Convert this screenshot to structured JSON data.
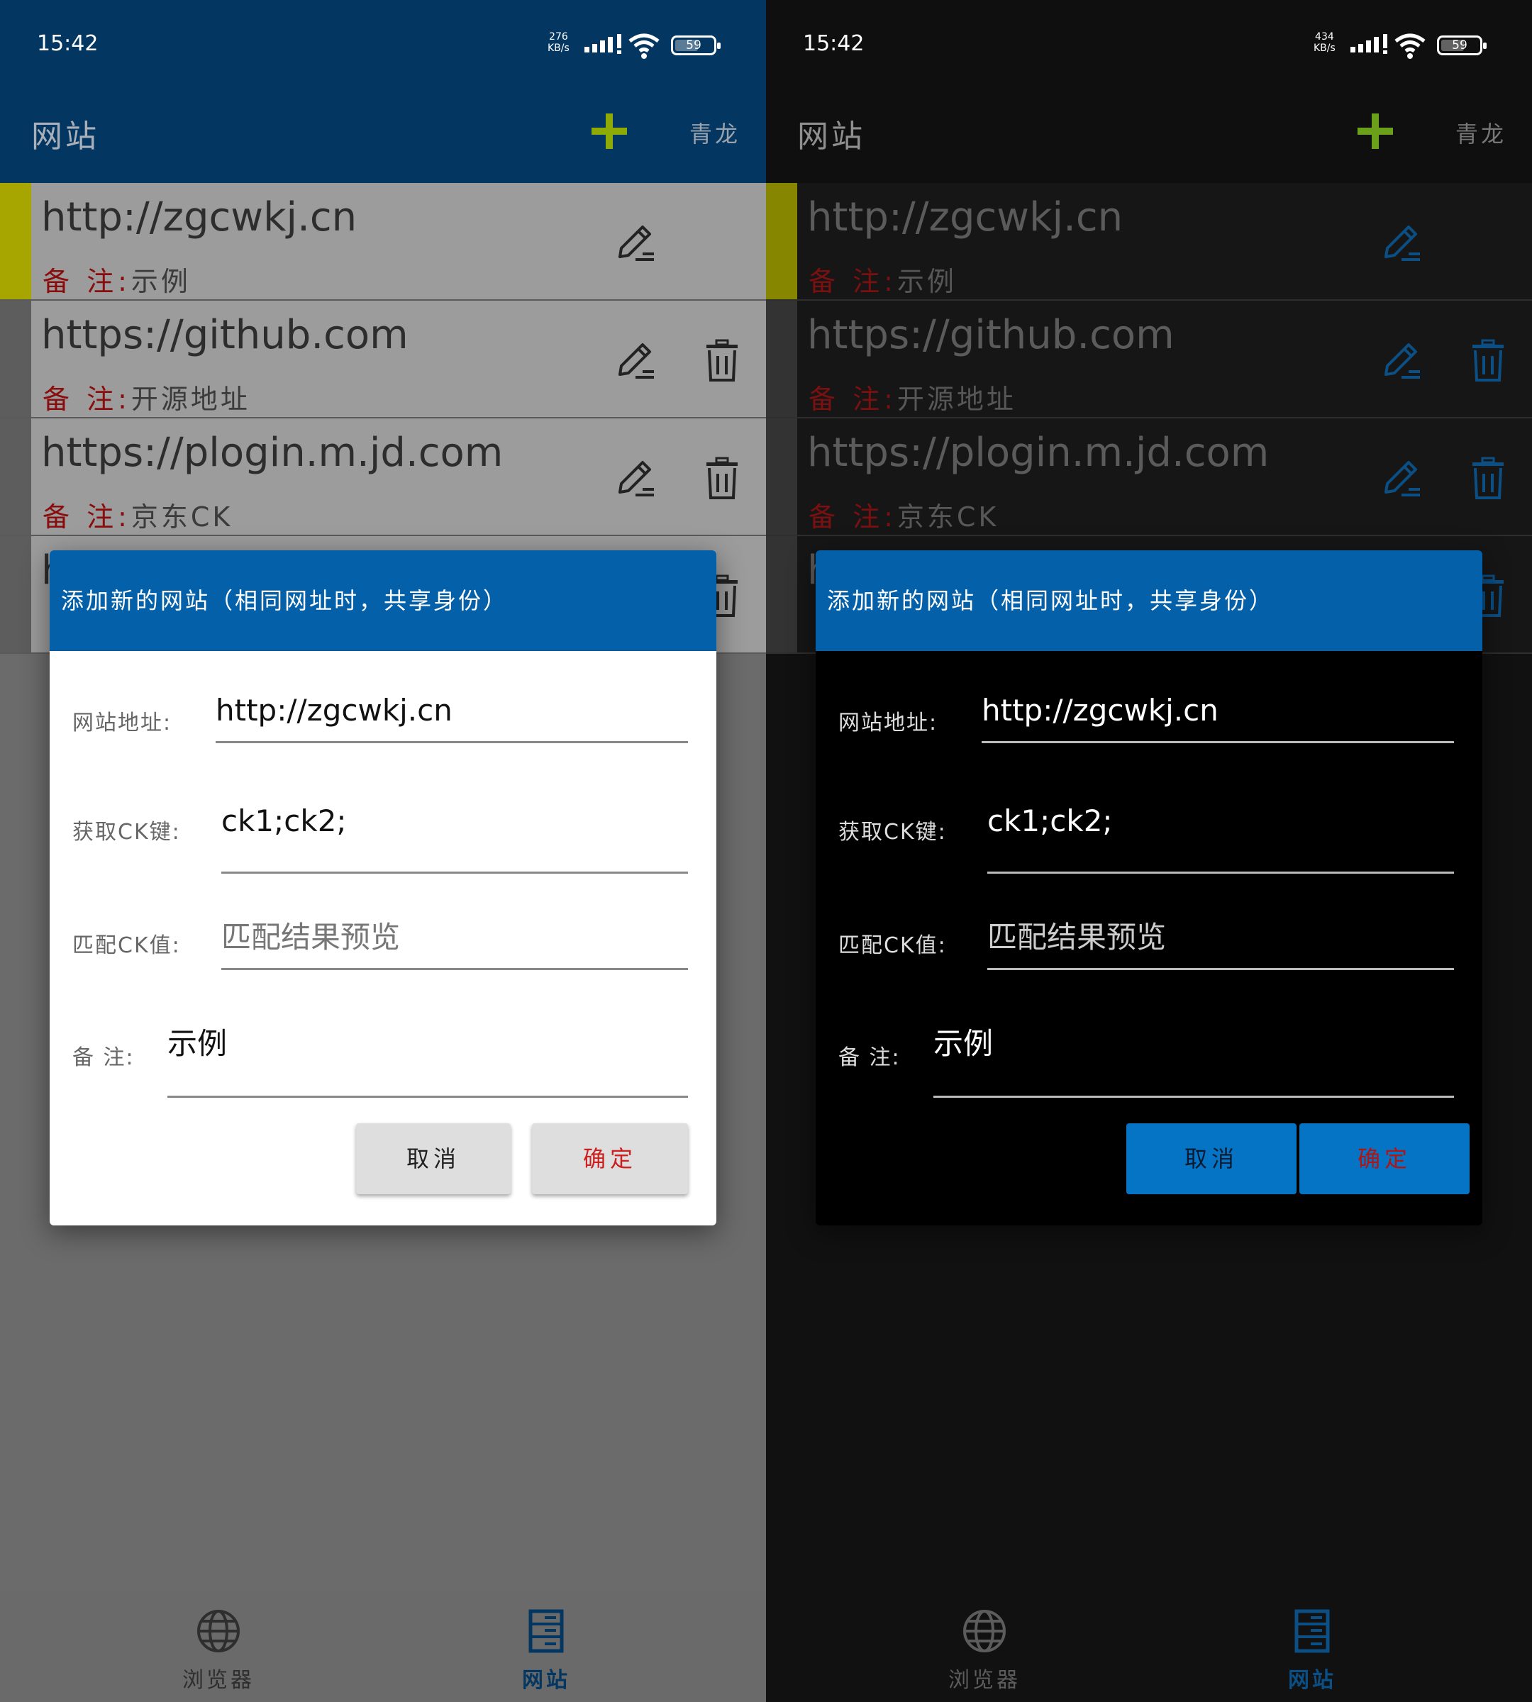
{
  "status": {
    "time": "15:42",
    "speed_light": "276",
    "speed_dark": "434",
    "speed_unit": "KB/s",
    "battery": "59"
  },
  "appbar": {
    "title": "网站",
    "add_icon": "plus-icon",
    "qinglong_label": "青龙"
  },
  "list": {
    "note_label": "备 注:",
    "items": [
      {
        "url": "http://zgcwkj.cn",
        "note": "示例",
        "deletable": false
      },
      {
        "url": "https://github.com",
        "note": "开源地址",
        "deletable": true
      },
      {
        "url": "https://plogin.m.jd.com",
        "note": "京东CK",
        "deletable": true
      },
      {
        "url": "h",
        "note": "",
        "deletable": true
      }
    ]
  },
  "dialog": {
    "title": "添加新的网站（相同网址时，共享身份）",
    "url_label": "网站地址:",
    "url_value": "http://zgcwkj.cn",
    "ck_key_label": "获取CK键:",
    "ck_key_value": "ck1;ck2;",
    "ck_value_label": "匹配CK值:",
    "ck_value_placeholder": "匹配结果预览",
    "note_label": "备 注:",
    "note_value": "示例",
    "cancel_label": "取消",
    "ok_label": "确定"
  },
  "bottomnav": {
    "browser_label": "浏览器",
    "site_label": "网站"
  },
  "colors": {
    "appbar_light": "#033660",
    "dialog_title": "#0460a8",
    "accent_green": "#8eaa06",
    "active_stripe": "#a7a600",
    "note_red": "#8a0d0d",
    "dark_button": "#0674c4"
  }
}
